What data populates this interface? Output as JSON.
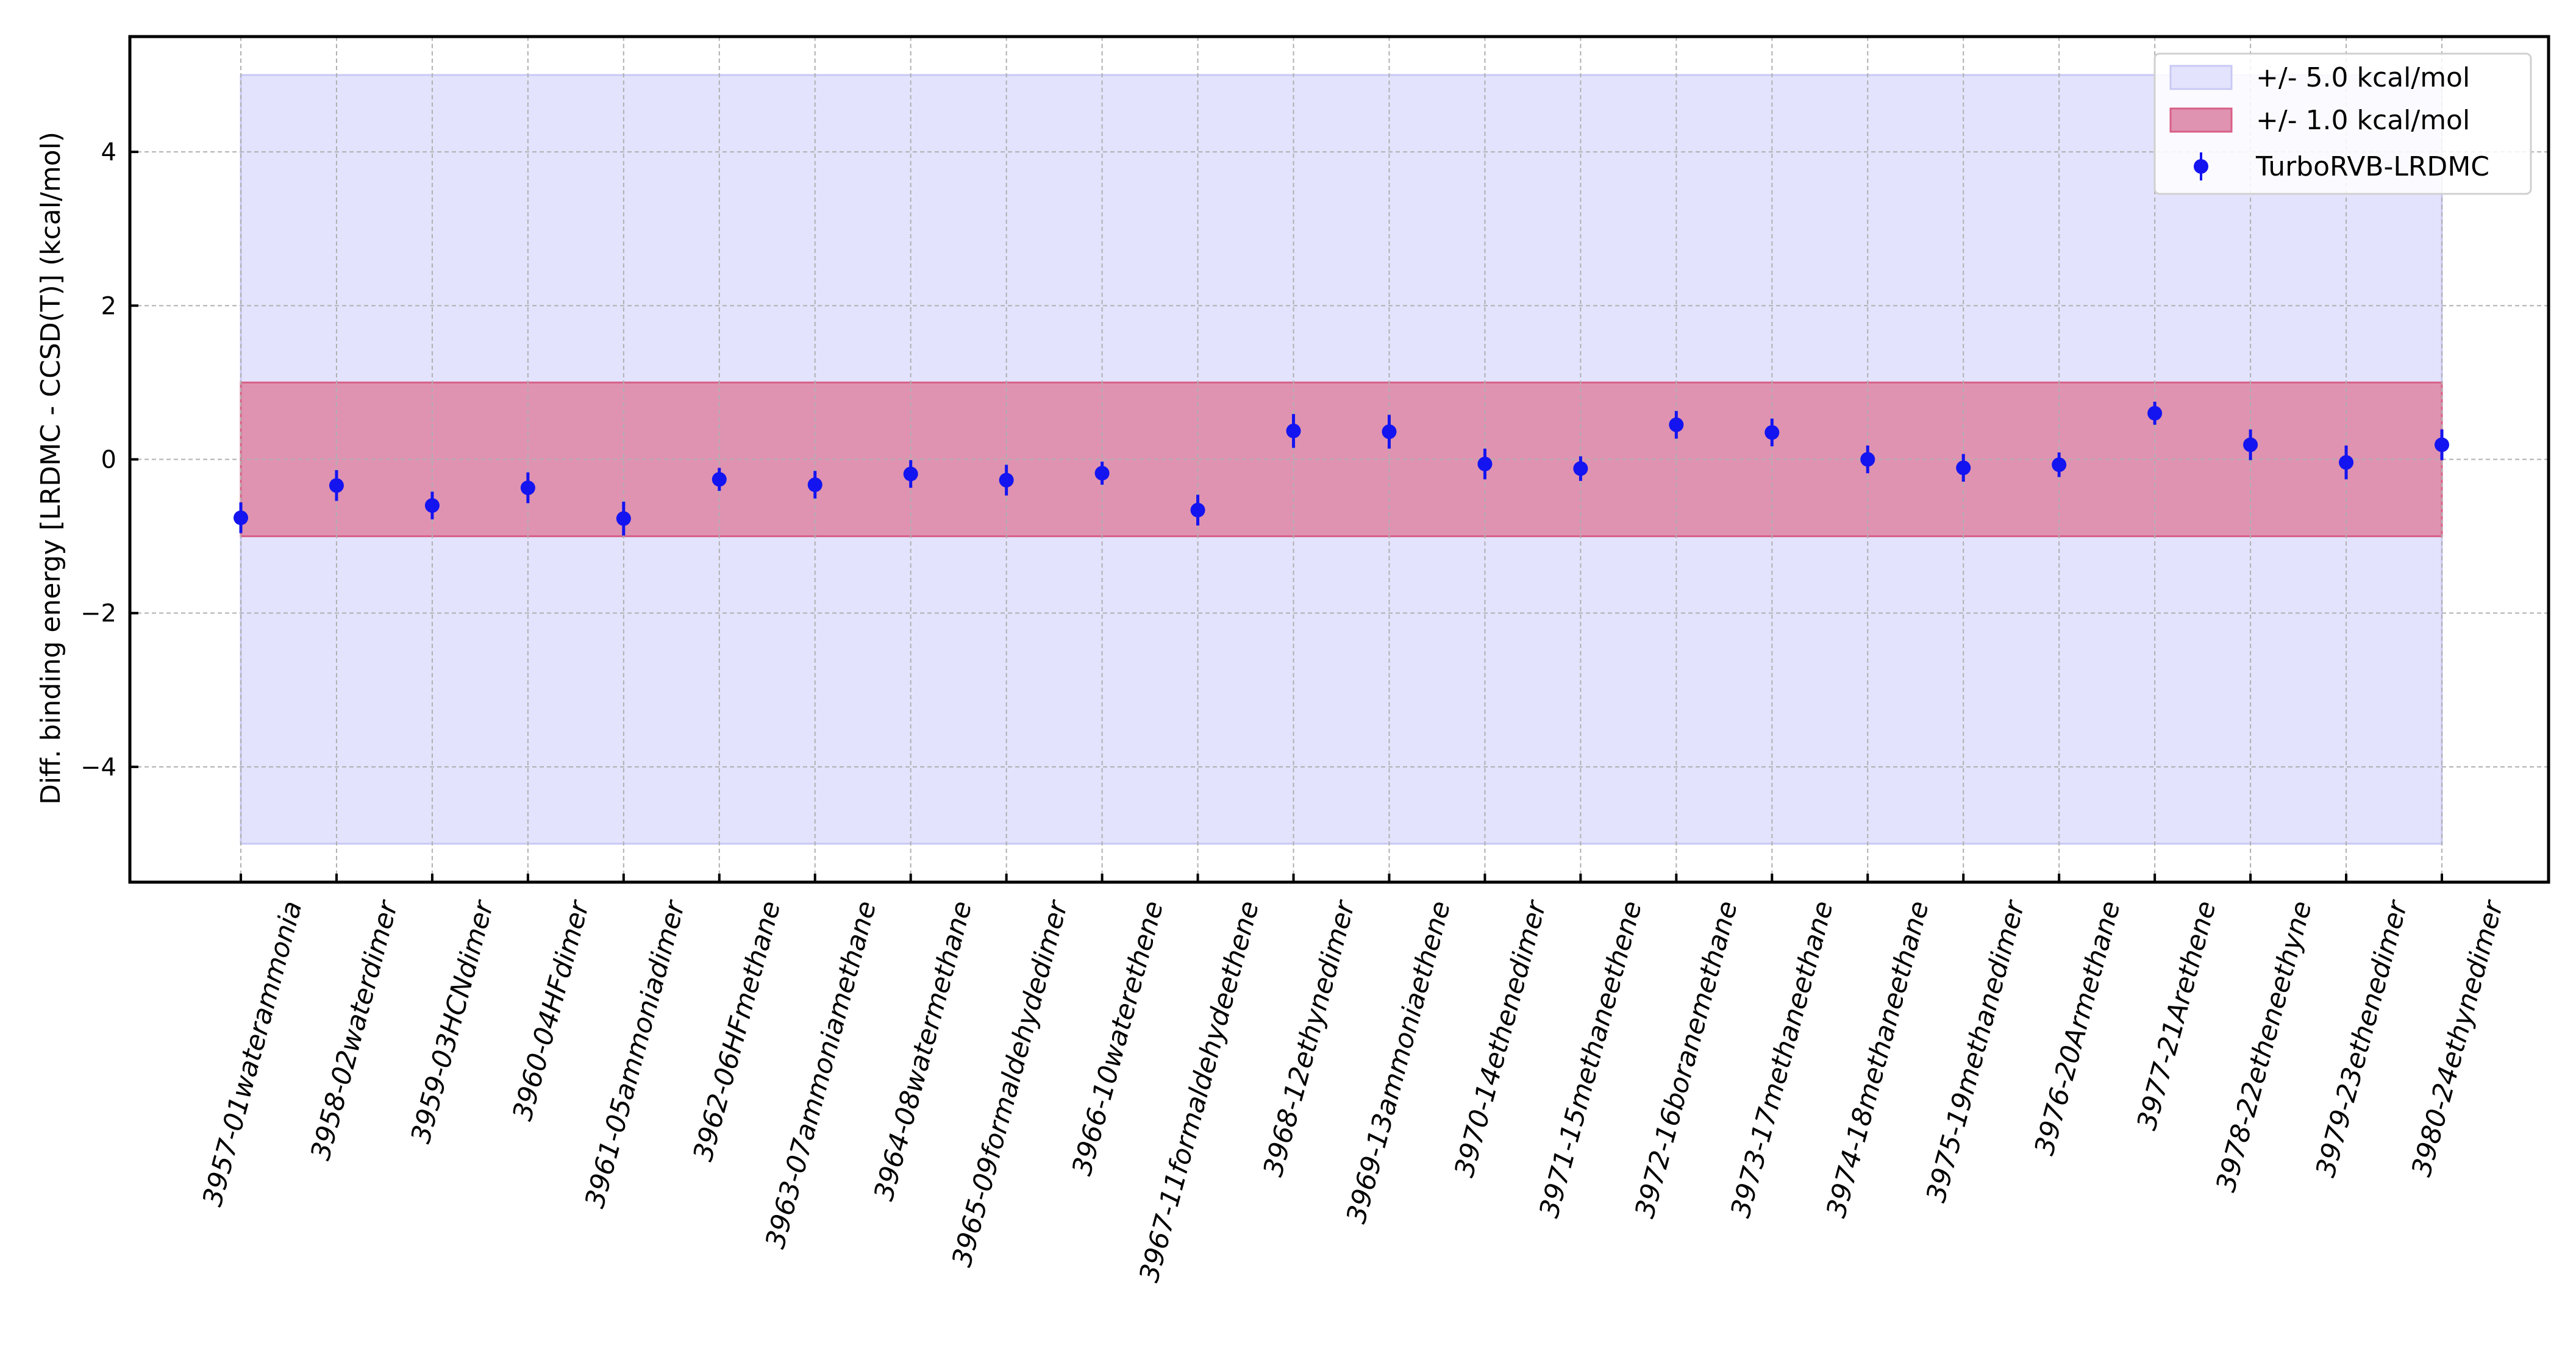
{
  "chart_data": {
    "type": "scatter",
    "title": "",
    "xlabel": "",
    "ylabel": "Diff. binding energy [LRDMC - CCSD(T)] (kcal/mol)",
    "ylim": [
      -5.5,
      5.5
    ],
    "yticks": [
      -4,
      -2,
      0,
      2,
      4
    ],
    "grid": true,
    "legend_position": "top-right",
    "categories": [
      "3957-01waterammonia",
      "3958-02waterdimer",
      "3959-03HCNdimer",
      "3960-04HFdimer",
      "3961-05ammoniadimer",
      "3962-06HFmethane",
      "3963-07ammoniamethane",
      "3964-08watermethane",
      "3965-09formaldehydedimer",
      "3966-10waterethene",
      "3967-11formaldehydeethene",
      "3968-12ethynedimer",
      "3969-13ammoniaethene",
      "3970-14ethenedimer",
      "3971-15methaneethene",
      "3972-16boranemethane",
      "3973-17methaneethane",
      "3974-18methaneethane",
      "3975-19methanedimer",
      "3976-20Armethane",
      "3977-21Arethene",
      "3978-22etheneethyne",
      "3979-23ethenedimer",
      "3980-24ethynedimer"
    ],
    "bands": [
      {
        "name": "+/- 5.0 kcal/mol",
        "lower": -5.0,
        "upper": 5.0,
        "color": "#e3e3fd",
        "edge": "#c9c9f5"
      },
      {
        "name": "+/- 1.0 kcal/mol",
        "lower": -1.0,
        "upper": 1.0,
        "color": "#df93b1",
        "edge": "#d85f86"
      }
    ],
    "series": [
      {
        "name": "TurboRVB-LRDMC",
        "color": "#1414f0",
        "values": [
          -0.76,
          -0.34,
          -0.6,
          -0.37,
          -0.77,
          -0.26,
          -0.33,
          -0.19,
          -0.27,
          -0.18,
          -0.66,
          0.37,
          0.36,
          -0.06,
          -0.12,
          0.45,
          0.35,
          0.0,
          -0.11,
          -0.07,
          0.6,
          0.19,
          -0.04,
          0.19
        ],
        "errors": [
          0.2,
          0.2,
          0.18,
          0.2,
          0.22,
          0.15,
          0.18,
          0.18,
          0.2,
          0.15,
          0.2,
          0.22,
          0.22,
          0.2,
          0.16,
          0.18,
          0.18,
          0.18,
          0.18,
          0.16,
          0.15,
          0.2,
          0.22,
          0.2
        ]
      }
    ]
  }
}
